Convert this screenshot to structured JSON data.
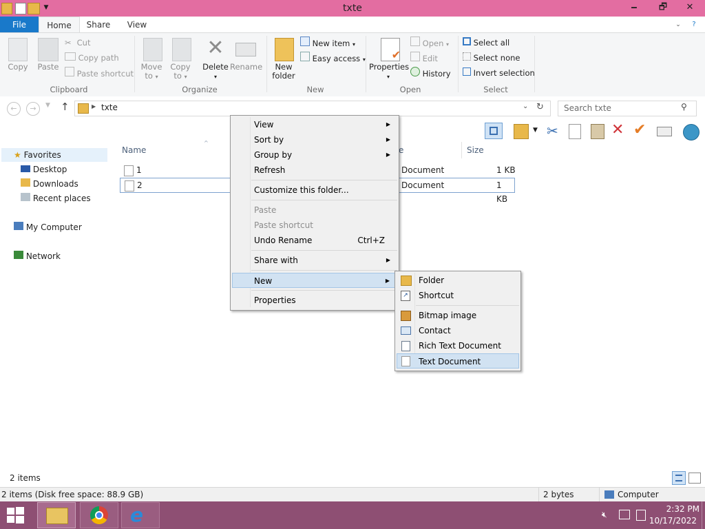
{
  "window": {
    "title": "txte",
    "minimize": "🗕",
    "maximize": "🗗",
    "close": "✕"
  },
  "ribbon": {
    "tabs": {
      "file": "File",
      "home": "Home",
      "share": "Share",
      "view": "View"
    },
    "clipboard": {
      "copy": "Copy",
      "paste": "Paste",
      "cut": "Cut",
      "copy_path": "Copy path",
      "paste_shortcut": "Paste shortcut",
      "label": "Clipboard"
    },
    "organize": {
      "move_to": "Move",
      "move_to2": "to",
      "copy_to": "Copy",
      "copy_to2": "to",
      "delete": "Delete",
      "rename": "Rename",
      "label": "Organize"
    },
    "new": {
      "new_folder": "New",
      "new_folder2": "folder",
      "new_item": "New item",
      "easy_access": "Easy access",
      "label": "New"
    },
    "open": {
      "properties": "Properties",
      "open": "Open",
      "edit": "Edit",
      "history": "History",
      "label": "Open"
    },
    "select": {
      "select_all": "Select all",
      "select_none": "Select none",
      "invert": "Invert selection",
      "label": "Select"
    }
  },
  "address": {
    "path": "txte",
    "search_placeholder": "Search txte"
  },
  "nav": {
    "favorites": "Favorites",
    "desktop": "Desktop",
    "downloads": "Downloads",
    "recent": "Recent places",
    "computer": "My Computer",
    "network": "Network"
  },
  "files": {
    "headers": {
      "name": "Name",
      "type": "e",
      "size": "Size"
    },
    "rows": [
      {
        "name": "1",
        "type": "Document",
        "size": "1 KB"
      },
      {
        "name": "2",
        "type": "Document",
        "size": "1 KB"
      }
    ]
  },
  "context_menu": {
    "view": "View",
    "sort_by": "Sort by",
    "group_by": "Group by",
    "refresh": "Refresh",
    "customize": "Customize this folder...",
    "paste": "Paste",
    "paste_shortcut": "Paste shortcut",
    "undo": "Undo Rename",
    "undo_shortcut": "Ctrl+Z",
    "share_with": "Share with",
    "new": "New",
    "properties": "Properties"
  },
  "submenu": {
    "folder": "Folder",
    "shortcut": "Shortcut",
    "bitmap": "Bitmap image",
    "contact": "Contact",
    "rtf": "Rich Text Document",
    "text": "Text Document"
  },
  "status": {
    "items": "2 items",
    "disk": "2 items (Disk free space: 88.9 GB)",
    "bytes": "2 bytes",
    "computer": "Computer"
  },
  "taskbar": {
    "time": "2:32 PM",
    "date": "10/17/2022"
  },
  "colors": {
    "titlebar": "#e36da1",
    "file_tab": "#1979ca",
    "taskbar": "#8e4f73",
    "highlight": "#d1e2f2"
  }
}
